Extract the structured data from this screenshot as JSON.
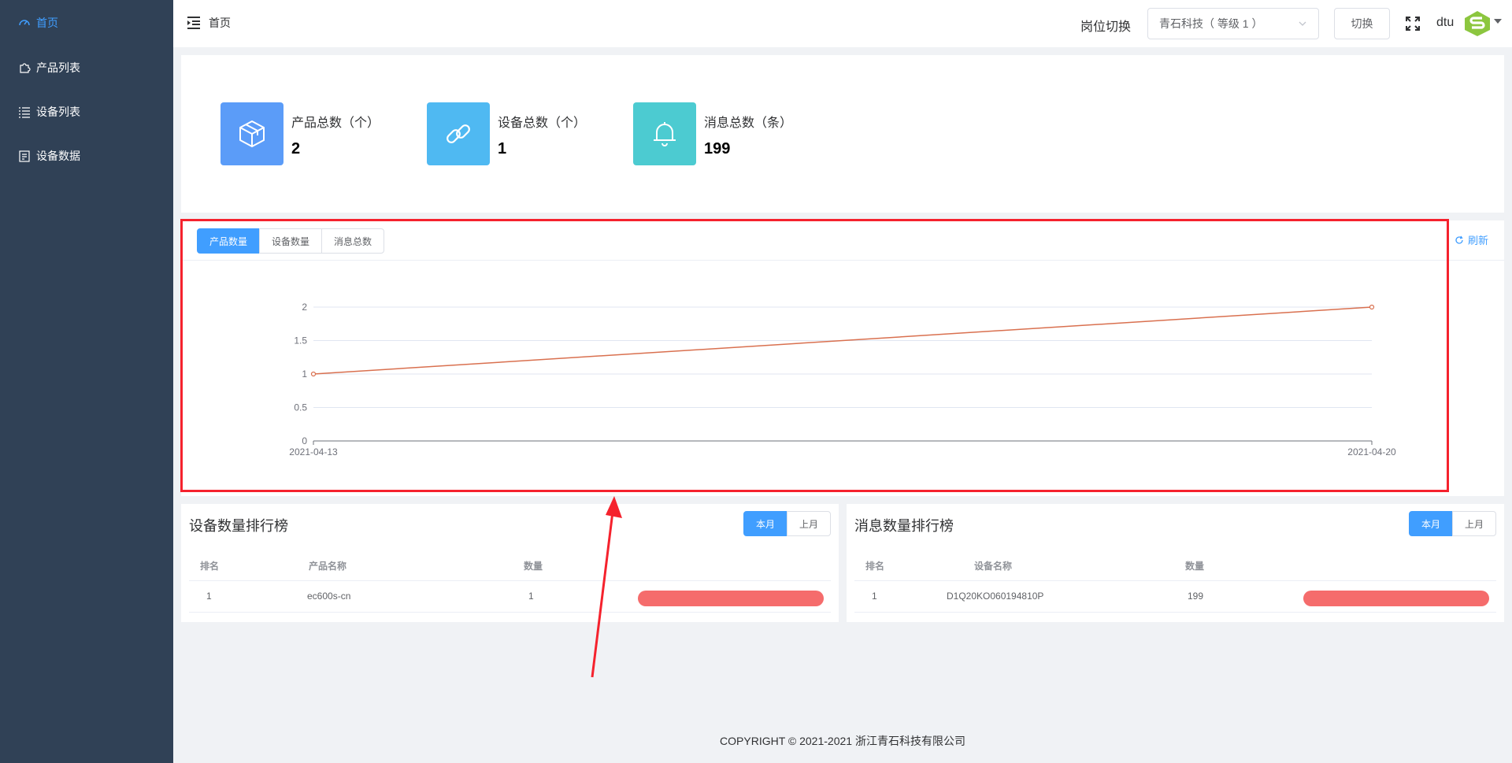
{
  "sidebar": {
    "items": [
      {
        "label": "首页",
        "icon": "dashboard-icon",
        "active": true
      },
      {
        "label": "产品列表",
        "icon": "puzzle-icon",
        "active": false
      },
      {
        "label": "设备列表",
        "icon": "list-icon",
        "active": false
      },
      {
        "label": "设备数据",
        "icon": "data-icon",
        "active": false
      }
    ]
  },
  "header": {
    "breadcrumb": "首页",
    "role_label": "岗位切换",
    "role_select_value": "青石科技（ 等级 1 ）",
    "switch_button": "切换",
    "username": "dtu"
  },
  "stats": [
    {
      "title": "产品总数（个）",
      "value": "2",
      "color": "#5b9cf8",
      "icon": "cube-icon"
    },
    {
      "title": "设备总数（个）",
      "value": "1",
      "color": "#4fb9f2",
      "icon": "link-icon"
    },
    {
      "title": "消息总数（条）",
      "value": "199",
      "color": "#4ccbd1",
      "icon": "bell-icon"
    }
  ],
  "chart_panel": {
    "tabs": [
      {
        "label": "产品数量",
        "active": true
      },
      {
        "label": "设备数量",
        "active": false
      },
      {
        "label": "消息总数",
        "active": false
      }
    ],
    "refresh_label": "刷新"
  },
  "chart_data": {
    "type": "line",
    "x": [
      "2021-04-13",
      "2021-04-20"
    ],
    "series": [
      {
        "values": [
          1,
          2
        ],
        "color": "#d9704f"
      }
    ],
    "ylim": [
      0,
      2
    ],
    "yticks": [
      "0",
      "0.5",
      "1",
      "1.5",
      "2"
    ],
    "grid": true,
    "title": "",
    "xlabel": "",
    "ylabel": ""
  },
  "device_rank": {
    "title": "设备数量排行榜",
    "buttons": [
      {
        "label": "本月",
        "active": true
      },
      {
        "label": "上月",
        "active": false
      }
    ],
    "columns": [
      "排名",
      "产品名称",
      "数量"
    ],
    "rows": [
      {
        "rank": "1",
        "name": "ec600s-cn",
        "count": "1",
        "fraction": 1.0
      }
    ]
  },
  "message_rank": {
    "title": "消息数量排行榜",
    "buttons": [
      {
        "label": "本月",
        "active": true
      },
      {
        "label": "上月",
        "active": false
      }
    ],
    "columns": [
      "排名",
      "设备名称",
      "数量"
    ],
    "rows": [
      {
        "rank": "1",
        "name": "D1Q20KO060194810P",
        "count": "199",
        "fraction": 1.0
      }
    ]
  },
  "footer": "COPYRIGHT © 2021-2021 浙江青石科技有限公司"
}
